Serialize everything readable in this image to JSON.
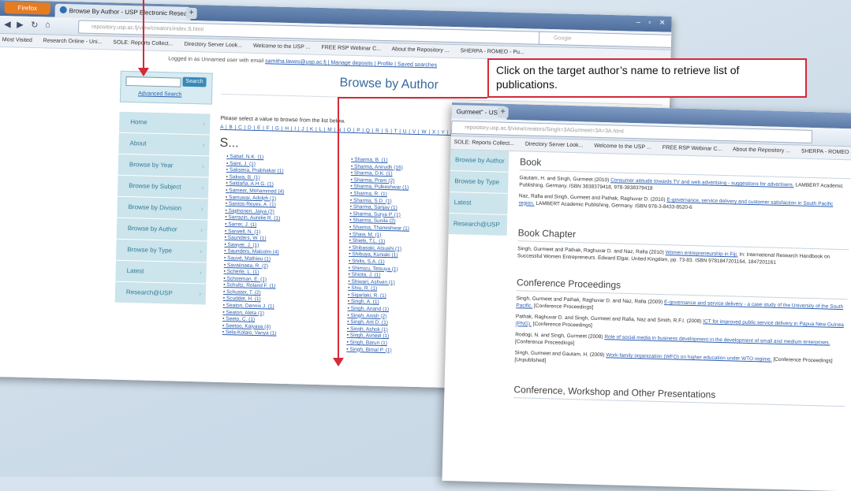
{
  "browser1": {
    "firefox_label": "Firefox",
    "tab_title": "Browse By Author - USP Electronic Research...",
    "url": "repository.usp.ac.fj/view/creators/index.S.html",
    "search_placeholder": "Google",
    "bookmarks": [
      "Most Visited",
      "Research Online - Uni...",
      "SOLE: Reports Collect...",
      "Directory Server Look...",
      "Welcome to the USP ...",
      "FREE RSP Webinar C...",
      "About the Repository ...",
      "SHERPA - ROMEO - Pu..."
    ]
  },
  "page1": {
    "logged_in_prefix": "Logged in as Unnamed user with email",
    "logged_in_links": "samitha.lawes@usp.ac.fj | Manage deposits | Profile | Saved searches",
    "search_button": "Search",
    "advanced_search": "Advanced Search",
    "nav": [
      "Home",
      "About",
      "Browse by Year",
      "Browse by Subject",
      "Browse by Division",
      "Browse by Author",
      "Browse by Type",
      "Latest",
      "Research@USP"
    ],
    "heading": "Browse by Author",
    "instruction": "Please select a value to browse from the list below.",
    "alphabet": "A | B | C | D | E | F | G | H | I | J | K | L | M | N | O | P | Q | R | S | T | U | V | W | X | Y | Z | (other)",
    "section_letter": "S...",
    "col1": [
      "Sabaf, N.K. (1)",
      "Saini, J. (1)",
      "Saksena, Prabhakar (1)",
      "Sakwa, B. (1)",
      "Saldaña, A.H.G. (1)",
      "Sameer, Mohammed (4)",
      "Samuwai, Adolph (1)",
      "Santos-Reyes, A. (1)",
      "Saphonen, Jaiya (2)",
      "Sarrazin, Aurelie R. (1)",
      "Sarrer, J. (1)",
      "Sarwell, N. (1)",
      "Saunders, W. (1)",
      "Sawyer, J. (1)",
      "Saunders, Malcolm (4)",
      "Sauvé, Mathieu (1)",
      "Savaiinaea, R. (2)",
      "Scherle, L. (1)",
      "Schoeman, E. (1)",
      "Schultz, Roland F. (1)",
      "Schuster, T. (2)",
      "Scudder, H. (1)",
      "Seaton, Dennis J. (1)",
      "Seaton, Aleta (1)",
      "Seeto, C. (1)",
      "Seetoo, Kaiyasa (4)",
      "Sela-Kolaio, Vanya (1)"
    ],
    "col2": [
      "Sharma, B. (1)",
      "Sharma, Anirudh (16)",
      "Sharma, D.K. (1)",
      "Sharma, Prem (2)",
      "Sharma, Pulkeshwar (1)",
      "Sharma, R. (1)",
      "Sharma, S.D. (1)",
      "Sharma, Sanjay (1)",
      "Sharma, Surya P. (1)",
      "Sharma, Sunila (2)",
      "Sharma, Thaneshwar (1)",
      "Shaw, M. (1)",
      "Shiels, T.L. (1)",
      "Shibasaki, Atsushi (1)",
      "Shibuya, Kuniaki (1)",
      "Shilts, S.A. (1)",
      "Shimizu, Tetsuya (1)",
      "Shiota, J. (1)",
      "Shiwari, Ashwin (1)",
      "Shiu, R. (1)",
      "Sigarlaki, R. (1)",
      "Singh, A. (1)",
      "Singh, Anand (1)",
      "Singh, Anish (2)",
      "Singh, Arti D. (1)",
      "Singh, Ashok (1)",
      "Singh, Avneel (1)",
      "Singh, Barun (1)",
      "Singh, Bimal P. (1)"
    ]
  },
  "browser2": {
    "tab_title": "Gurmeet\" - USP",
    "url": "repository.usp.ac.fj/view/creators/Singh=3AGurmeet=3A=3A.html",
    "bookmarks": [
      "SOLE: Reports Collect...",
      "Directory Server Look...",
      "Welcome to the USP ...",
      "FREE RSP Webinar C...",
      "About the Repository ...",
      "SHERPA - ROMEO - Pu..."
    ]
  },
  "page2": {
    "nav": [
      "Browse by Author",
      "Browse by Type",
      "Latest",
      "Research@USP"
    ],
    "sections": [
      {
        "title": "Book",
        "entries": [
          {
            "text": "Gautam, H. and Singh, Gurmeet (2010)",
            "link": "Consumer attitude towards TV and web advertising - suggestions for advertisers.",
            "rest": "LAMBERT Academic Publishing, Germany. ISBN 3838379418, 978-3838379418"
          },
          {
            "text": "Naz, Rafia and Singh, Gurmeet and Pathak, Raghuvar D. (2010)",
            "link": "E-governance, service delivery and customer satisfaction in South Pacific region.",
            "rest": "LAMBERT Academic Publishing, Germany. ISBN 978-3-8433-8520-6"
          }
        ]
      },
      {
        "title": "Book Chapter",
        "entries": [
          {
            "text": "Singh, Gurmeet and Pathak, Raghuvar D. and Naz, Rafia (2010)",
            "link": "Women entrepreneurship in Fiji.",
            "rest": "In: International Research Handbook on Successful Women Entrepreneurs. Edward Elgar, United Kingdom, pp. 73-83. ISBN 9781847201164, 1847201161"
          }
        ]
      },
      {
        "title": "Conference Proceedings",
        "entries": [
          {
            "text": "Singh, Gurmeet and Pathak, Raghuvar D. and Naz, Rafia (2009)",
            "link": "E-governance and service delivery - a case study of the University of the South Pacific.",
            "rest": "[Conference Proceedings]"
          },
          {
            "text": "Pathak, Raghuvar D. and Singh, Gurmeet and Rafia, Naz and Smith, R.F.I. (2008)",
            "link": "ICT for improved public service delivery in Papua New Guinea (PNG).",
            "rest": "[Conference Proceedings]"
          },
          {
            "text": "Rodogi, N. and Singh, Gurmeet (2008)",
            "link": "Role of social media in business development in the development of small and medium enterprises.",
            "rest": "[Conference Proceedings]"
          },
          {
            "text": "Singh, Gurmeet and Gautam, H. (2009)",
            "link": "Work-family organization (WFO) on higher education under WTO regime.",
            "rest": "[Conference Proceedings] [Unpublished]"
          }
        ]
      },
      {
        "title": "Conference, Workshop and Other Presentations",
        "entries": []
      }
    ]
  },
  "callout": {
    "text": "Click on the target author’s name to retrieve list of publications."
  },
  "colors": {
    "accent_red": "#d42a3a",
    "link_blue": "#2a5db0",
    "nav_teal": "#2f7d96"
  }
}
